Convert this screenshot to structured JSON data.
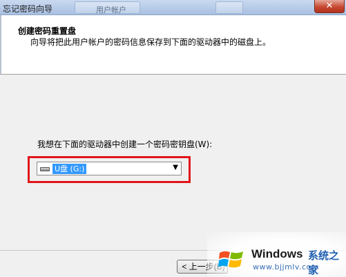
{
  "window": {
    "title": "忘记密码向导",
    "background_tab_label": "用户帐户",
    "close_label": "✕"
  },
  "header": {
    "title": "创建密码重置盘",
    "subtitle": "向导将把此用户帐户的密码信息保存到下面的驱动器中的磁盘上。"
  },
  "main": {
    "prompt_label": "我想在下面的驱动器中创建一个密码密钥盘(W):",
    "drive_select": {
      "selected_value": "U盘 (G:)",
      "icon": "usb-drive-icon"
    }
  },
  "footer": {
    "back_label": "< 上一步(B)"
  },
  "watermark": {
    "brand": "Windows",
    "brand_cn": "系统之家",
    "url": "www.bjjmlv.com"
  },
  "colors": {
    "highlight": "#e0161a",
    "selection": "#3399ff",
    "titlebar": "#a9c0e2"
  }
}
